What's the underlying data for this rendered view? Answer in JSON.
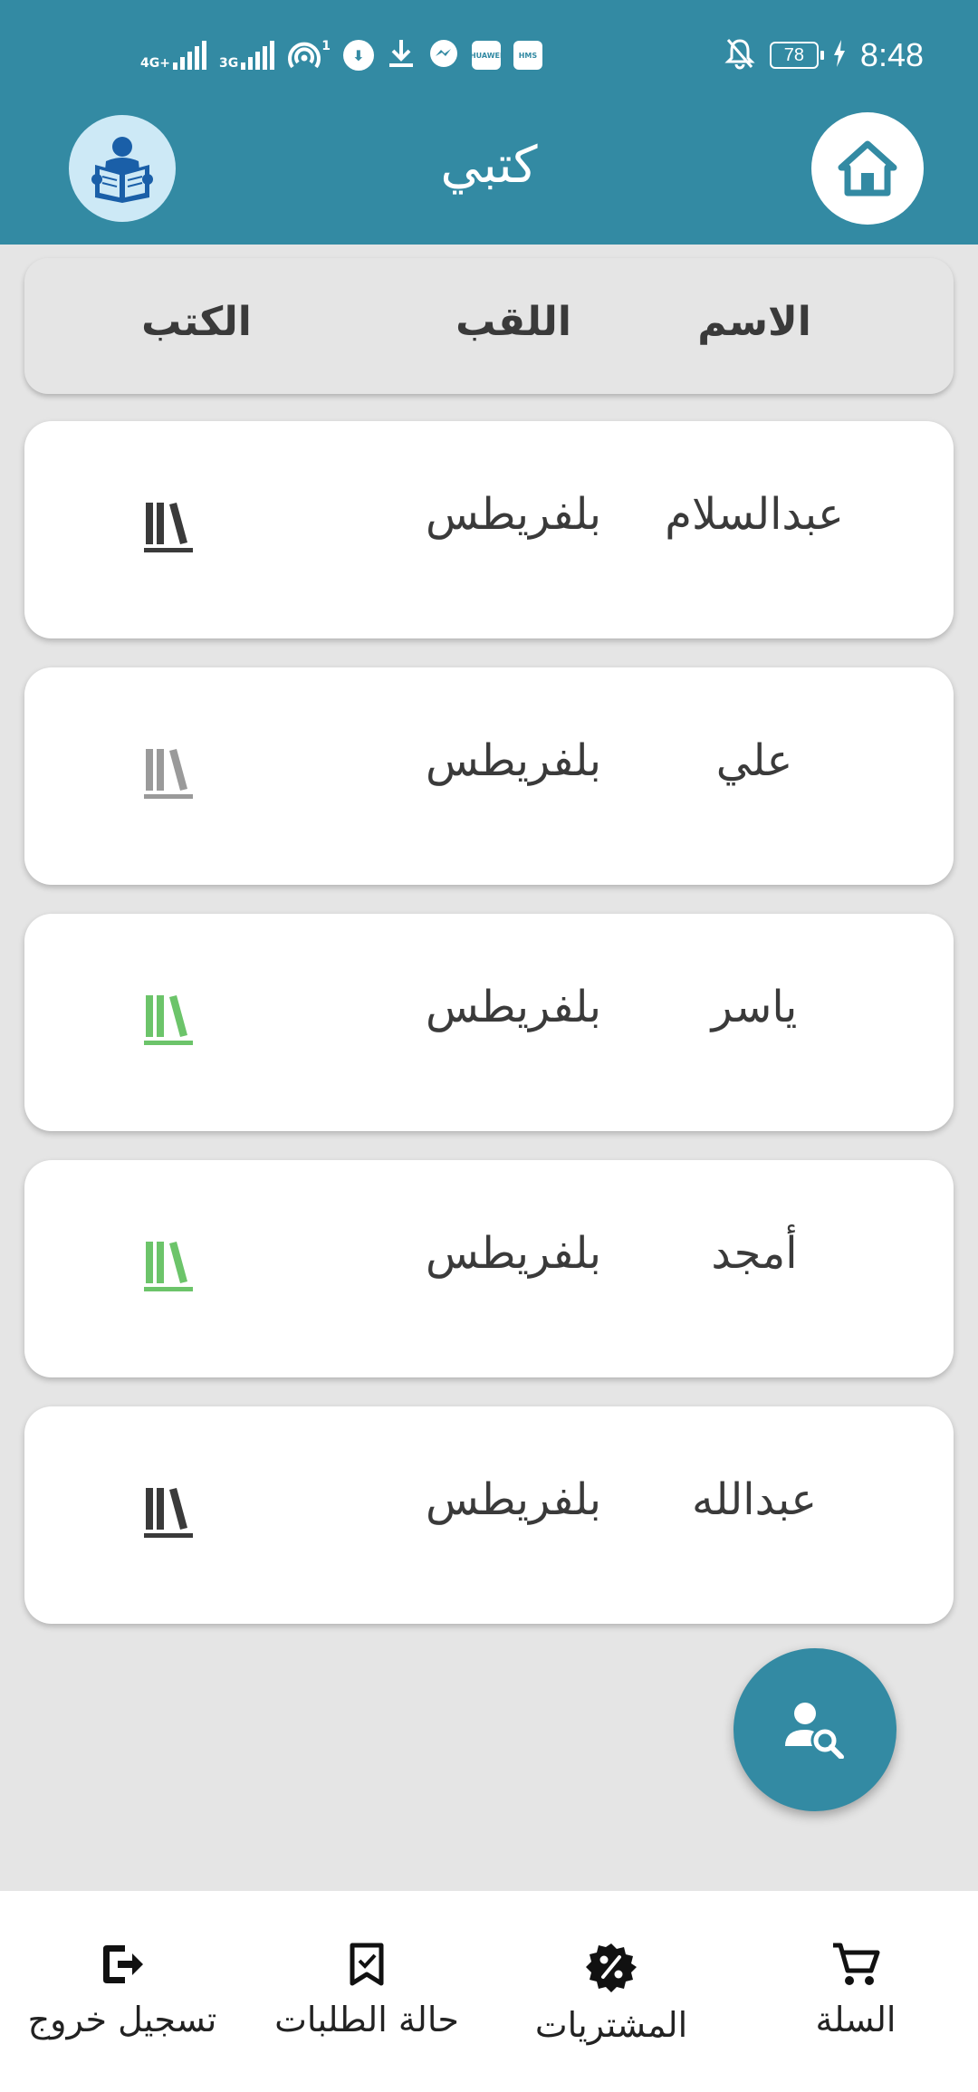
{
  "status_bar": {
    "network_1": "4G+",
    "network_2": "3G",
    "hotspot_count": "1",
    "hms_label": "HMS",
    "huawei_label": "HUAWEI",
    "battery": "78",
    "time": "8:48"
  },
  "app_bar": {
    "title": "كتبي",
    "home_icon": "home-icon",
    "logo_icon": "reading-person-icon"
  },
  "table": {
    "headers": {
      "name": "الاسم",
      "surname": "اللقب",
      "books": "الكتب"
    },
    "rows": [
      {
        "name": "عبدالسلام",
        "surname": "بلفريطس",
        "books_icon_color": "#3a3a3a"
      },
      {
        "name": "علي",
        "surname": "بلفريطس",
        "books_icon_color": "#9a9a9a"
      },
      {
        "name": "ياسر",
        "surname": "بلفريطس",
        "books_icon_color": "#6cc46a"
      },
      {
        "name": "أمجد",
        "surname": "بلفريطس",
        "books_icon_color": "#6cc46a"
      },
      {
        "name": "عبدالله",
        "surname": "بلفريطس",
        "books_icon_color": "#3a3a3a"
      }
    ]
  },
  "fab": {
    "icon": "person-search-icon"
  },
  "bottom_nav": {
    "items": [
      {
        "label": "تسجيل خروج",
        "icon": "logout-icon"
      },
      {
        "label": "حالة الطلبات",
        "icon": "bookmark-check-icon"
      },
      {
        "label": "المشتريات",
        "icon": "discount-badge-icon"
      },
      {
        "label": "السلة",
        "icon": "cart-icon"
      }
    ]
  },
  "colors": {
    "primary": "#338aa3",
    "background": "#e5e5e5",
    "logo_bg": "#cde9f6",
    "logo_fg": "#1a5fa8"
  }
}
